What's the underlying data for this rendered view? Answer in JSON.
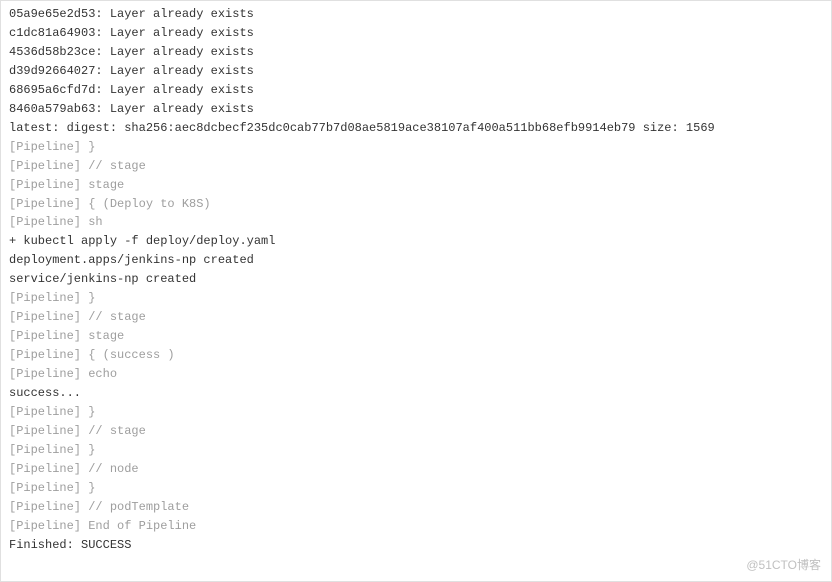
{
  "log": {
    "layers": [
      {
        "hash": "05a9e65e2d53",
        "msg": "Layer already exists"
      },
      {
        "hash": "c1dc81a64903",
        "msg": "Layer already exists"
      },
      {
        "hash": "4536d58b23ce",
        "msg": "Layer already exists"
      },
      {
        "hash": "d39d92664027",
        "msg": "Layer already exists"
      },
      {
        "hash": "68695a6cfd7d",
        "msg": "Layer already exists"
      },
      {
        "hash": "8460a579ab63",
        "msg": "Layer already exists"
      }
    ],
    "digest_line": "latest: digest: sha256:aec8dcbecf235dc0cab77b7d08ae5819ace38107af400a511bb68efb9914eb79 size: 1569",
    "pipeline_group1": [
      "[Pipeline] }",
      "[Pipeline] // stage",
      "[Pipeline] stage",
      "[Pipeline] { (Deploy to K8S)",
      "[Pipeline] sh"
    ],
    "kubectl_cmd": "+ kubectl apply -f deploy/deploy.yaml",
    "kubectl_out1": "deployment.apps/jenkins-np created",
    "kubectl_out2": "service/jenkins-np created",
    "pipeline_group2": [
      "[Pipeline] }",
      "[Pipeline] // stage",
      "[Pipeline] stage",
      "[Pipeline] { (success )",
      "[Pipeline] echo"
    ],
    "success_msg": "success...",
    "pipeline_group3": [
      "[Pipeline] }",
      "[Pipeline] // stage",
      "[Pipeline] }",
      "[Pipeline] // node",
      "[Pipeline] }",
      "[Pipeline] // podTemplate",
      "[Pipeline] End of Pipeline"
    ],
    "finished": "Finished: SUCCESS"
  },
  "watermark": "@51CTO博客"
}
